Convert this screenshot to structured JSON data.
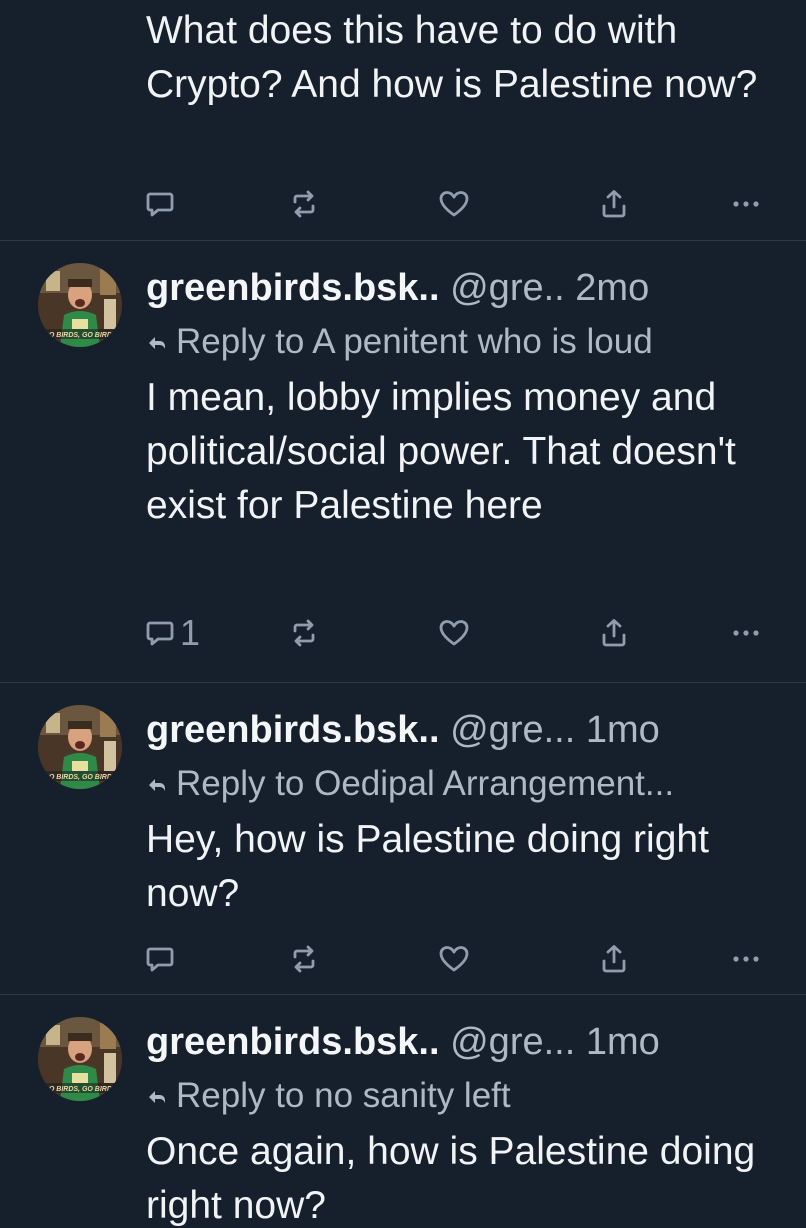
{
  "colors": {
    "background": "#16202c",
    "text": "#f1f3f5",
    "muted": "#aeb9c6",
    "icon": "#8f9dad",
    "divider": "#2c3a4a"
  },
  "posts": [
    {
      "body": "What does this have to do with Crypto? And how is Palestine now?",
      "reply_count": ""
    },
    {
      "author": "greenbirds.bsk..",
      "handle": "@gre..",
      "time": "2mo",
      "reply_to": "Reply to A penitent who is loud",
      "body": "I mean, lobby implies money and political/social power. That doesn't exist for Palestine here",
      "reply_count": "1"
    },
    {
      "author": "greenbirds.bsk..",
      "handle": "@gre...",
      "time": "1mo",
      "reply_to": "Reply to Oedipal Arrangement...",
      "body": "Hey, how is Palestine doing right now?",
      "reply_count": ""
    },
    {
      "author": "greenbirds.bsk..",
      "handle": "@gre...",
      "time": "1mo",
      "reply_to": "Reply to no sanity left",
      "body": "Once again, how is Palestine doing right now?",
      "reply_count": ""
    }
  ],
  "icons": {
    "reply": "comment-bubble-icon",
    "repost": "repost-arrows-icon",
    "like": "heart-icon",
    "share": "share-upload-icon",
    "more": "more-dots-icon",
    "reply_to": "reply-arrow-icon"
  }
}
